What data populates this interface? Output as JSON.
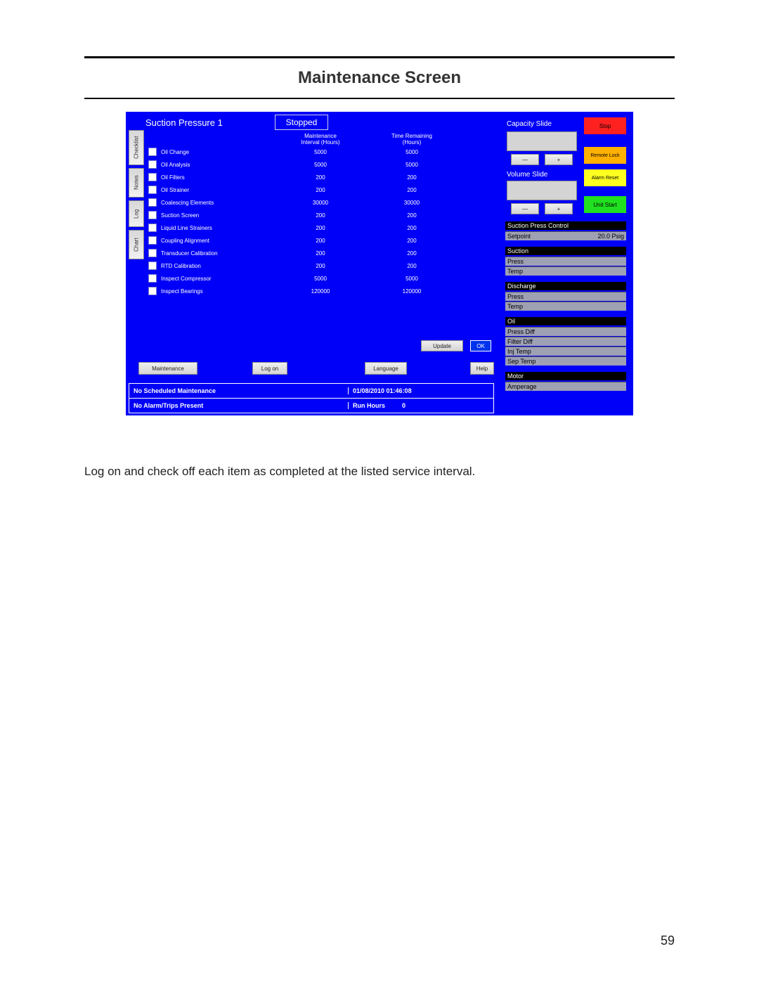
{
  "pageTitle": "Maintenance Screen",
  "caption": "Log on and check off each item as completed at the listed service interval.",
  "pageNumber": "59",
  "header": {
    "suctionPressure": "Suction Pressure 1",
    "status": "Stopped"
  },
  "tabs": {
    "checklist": "Checklist",
    "notes": "Notes",
    "log": "Log",
    "chart": "Chart"
  },
  "tableHeaders": {
    "interval": "Maintenance\nInterval (Hours)",
    "remaining": "Time Remaining\n(Hours)"
  },
  "rows": [
    {
      "name": "Oil Change",
      "interval": "5000",
      "remaining": "5000"
    },
    {
      "name": "Oil Analysis",
      "interval": "5000",
      "remaining": "5000"
    },
    {
      "name": "Oil Filters",
      "interval": "200",
      "remaining": "200"
    },
    {
      "name": "Oil Strainer",
      "interval": "200",
      "remaining": "200"
    },
    {
      "name": "Coalescing Elements",
      "interval": "30000",
      "remaining": "30000"
    },
    {
      "name": "Suction Screen",
      "interval": "200",
      "remaining": "200"
    },
    {
      "name": "Liquid Line Strainers",
      "interval": "200",
      "remaining": "200"
    },
    {
      "name": "Coupling Alignment",
      "interval": "200",
      "remaining": "200"
    },
    {
      "name": "Transducer Calibration",
      "interval": "200",
      "remaining": "200"
    },
    {
      "name": "RTD Calibration",
      "interval": "200",
      "remaining": "200"
    },
    {
      "name": "Inspect Compressor",
      "interval": "5000",
      "remaining": "5000"
    },
    {
      "name": "Inspect Bearings",
      "interval": "120000",
      "remaining": "120000"
    }
  ],
  "buttons": {
    "update": "Update",
    "ok": "OK",
    "maintenance": "Maintenance",
    "logon": "Log on",
    "language": "Language",
    "help": "Help",
    "stop": "Stop",
    "remoteLock": "Remote Lock",
    "alarmReset": "Alarm Reset",
    "unitStart": "Unit Start",
    "minus": "—",
    "plus": "+"
  },
  "right": {
    "capSlide": "Capacity Slide",
    "volSlide": "Volume Slide",
    "spc": "Suction Press Control",
    "setpointLabel": "Setpoint",
    "setpointValue": "20.0 Psig",
    "suction": "Suction",
    "press": "Press",
    "temp": "Temp",
    "discharge": "Discharge",
    "oil": "Oil",
    "pressDiff": "Press Diff",
    "filterDiff": "Filter Diff",
    "injTemp": "Inj Temp",
    "sepTemp": "Sep Temp",
    "motor": "Motor",
    "amperage": "Amperage"
  },
  "status": {
    "sched": "No Scheduled Maintenance",
    "datetime": "01/08/2010  01:46:08",
    "alarm": "No Alarm/Trips Present",
    "runHoursLabel": "Run Hours",
    "runHoursValue": "0"
  }
}
